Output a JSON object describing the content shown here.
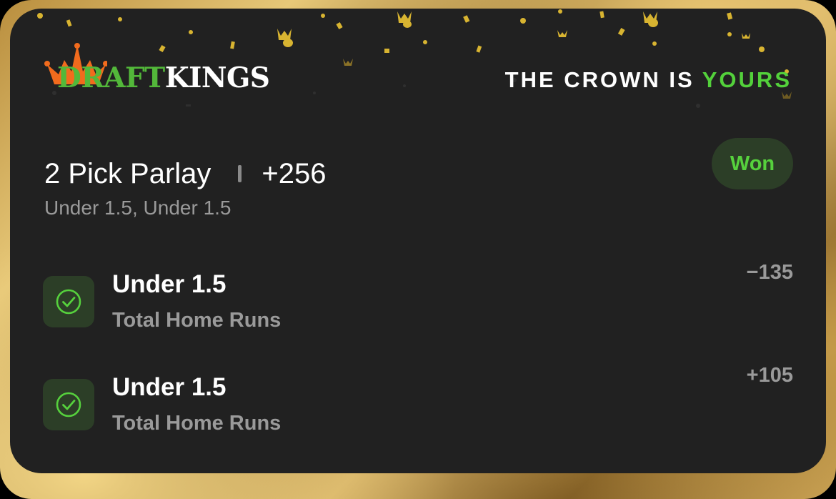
{
  "brand": {
    "logo_part1": "DRAFT",
    "logo_part2": "KINGS",
    "tagline_part1": "THE CROWN IS ",
    "tagline_part2": "YOURS",
    "colors": {
      "green": "#53B83A",
      "accent_green": "#53D13B",
      "orange": "#F26B1D",
      "gold": "#E7C878"
    }
  },
  "bet": {
    "title": "2 Pick Parlay",
    "odds": "+256",
    "summary": "Under 1.5, Under 1.5",
    "status": "Won"
  },
  "legs": [
    {
      "selection": "Under 1.5",
      "market": "Total Home Runs",
      "odds": "−135",
      "icon": "check-circle-icon",
      "result": "won"
    },
    {
      "selection": "Under 1.5",
      "market": "Total Home Runs",
      "odds": "+105",
      "icon": "check-circle-icon",
      "result": "won"
    }
  ]
}
